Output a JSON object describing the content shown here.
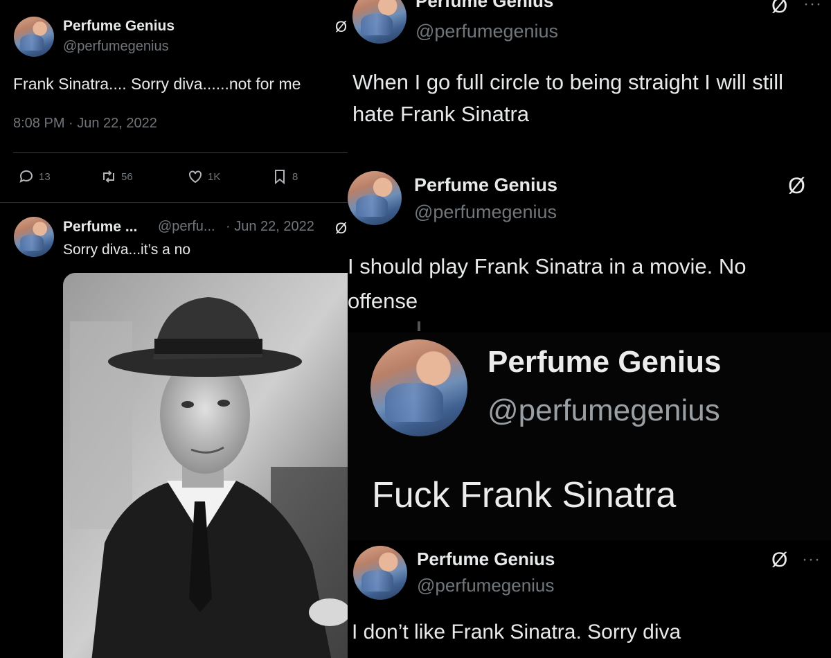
{
  "tweet1": {
    "name": "Perfume Genius",
    "handle": "@perfumegenius",
    "text": "Frank Sinatra.... Sorry diva......not for me",
    "timestamp": "8:08 PM · Jun 22, 2022",
    "replies": "13",
    "reposts": "56",
    "likes": "1K",
    "bookmarks": "8"
  },
  "tweet2": {
    "name": "Perfume ...",
    "handle": "@perfu...",
    "date": "· Jun 22, 2022",
    "text": "Sorry diva...it’s a no"
  },
  "tweet3": {
    "name": "Perfume Genius",
    "handle": "@perfumegenius",
    "text": "When I go full circle to being straight I will still hate Frank Sinatra"
  },
  "tweet4": {
    "name": "Perfume Genius",
    "handle": "@perfumegenius",
    "text": "I should play Frank Sinatra in a movie. No offense"
  },
  "tweet5": {
    "name": "Perfume Genius",
    "handle": "@perfumegenius",
    "text": "Fuck Frank Sinatra"
  },
  "tweet6": {
    "name": "Perfume Genius",
    "handle": "@perfumegenius",
    "text": "I don’t like Frank Sinatra. Sorry diva"
  },
  "icons": {
    "grok": "Ø",
    "more": "···"
  },
  "colors": {
    "background": "#000000",
    "primary_text": "#e7e9ea",
    "secondary_text": "#71767b"
  }
}
